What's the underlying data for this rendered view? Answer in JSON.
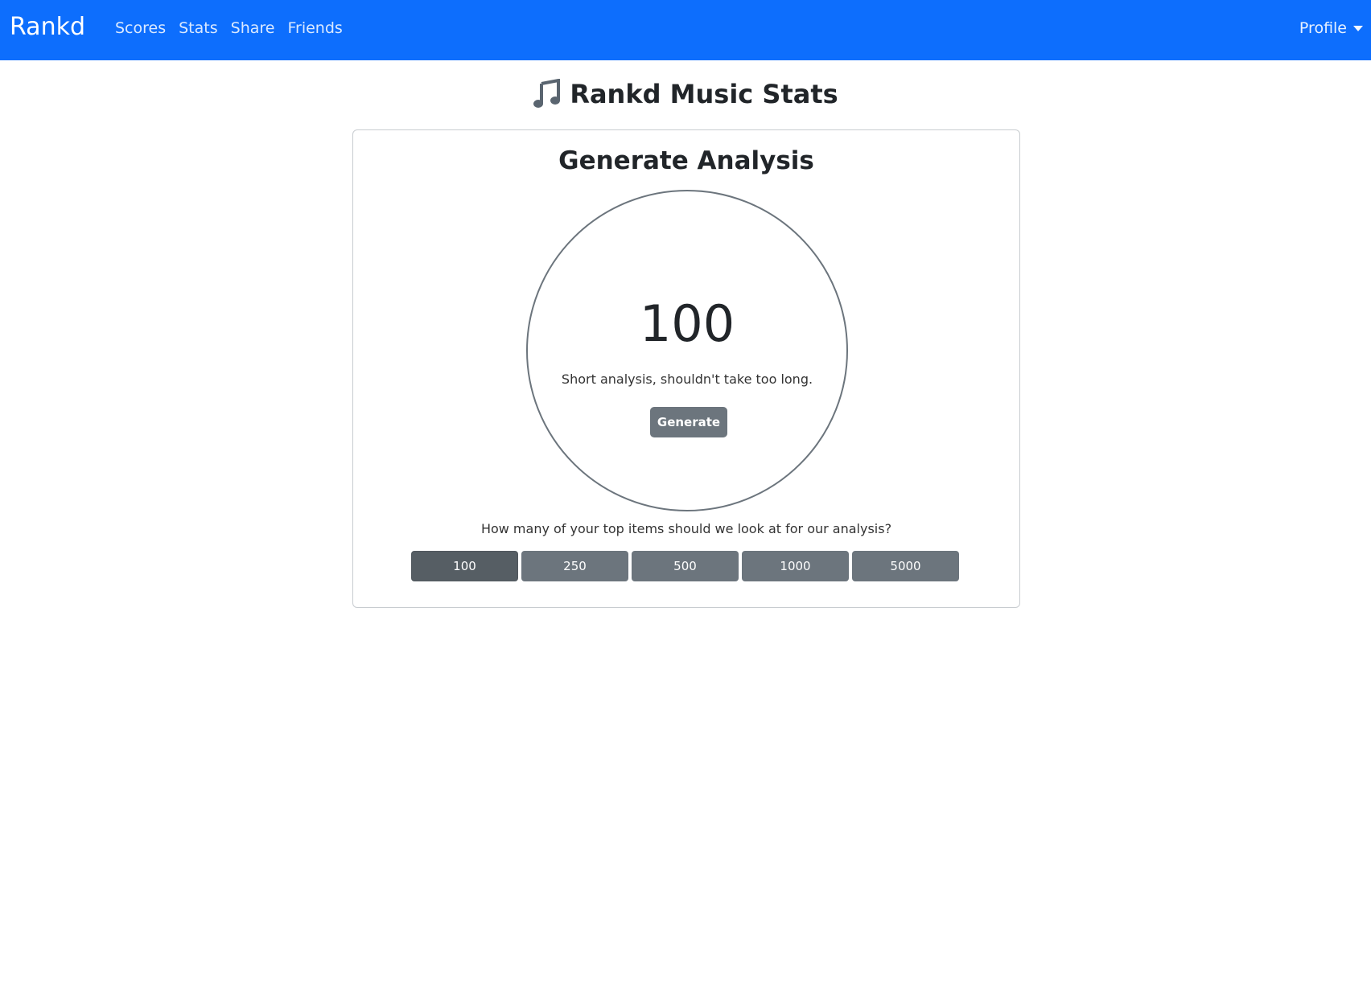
{
  "navbar": {
    "brand": "Rankd",
    "links": [
      "Scores",
      "Stats",
      "Share",
      "Friends"
    ],
    "profile_label": "Profile",
    "bg_color": "#0d6efd"
  },
  "page": {
    "title": "Rankd Music Stats",
    "title_icon": "music-note-icon"
  },
  "analysis": {
    "title": "Generate Analysis",
    "selected_count": "100",
    "description": "Short analysis, shouldn't take too long.",
    "generate_label": "Generate",
    "question": "How many of your top items should we look at for our analysis?",
    "options": [
      "100",
      "250",
      "500",
      "1000",
      "5000"
    ],
    "selected_option": "100"
  }
}
